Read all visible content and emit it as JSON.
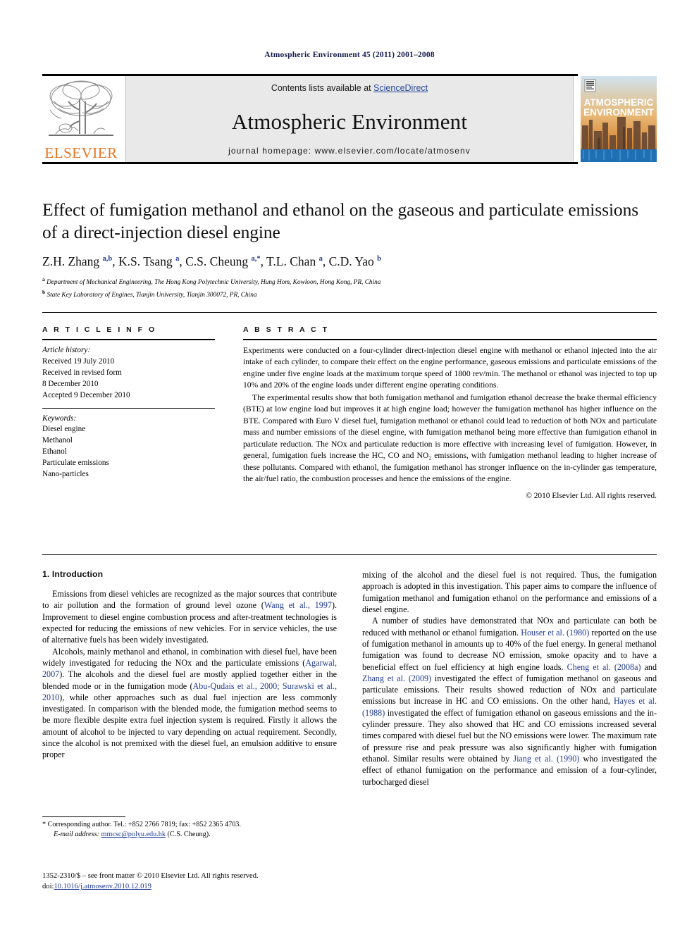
{
  "running_head": "Atmospheric Environment 45 (2011) 2001–2008",
  "masthead": {
    "contents_prefix": "Contents lists available at ",
    "contents_link": "ScienceDirect",
    "journal_name": "Atmospheric Environment",
    "homepage": "journal homepage: www.elsevier.com/locate/atmosenv",
    "publisher": "ELSEVIER",
    "cover_title_line1": "ATMOSPHERIC",
    "cover_title_line2": "ENVIRONMENT"
  },
  "article": {
    "title": "Effect of fumigation methanol and ethanol on the gaseous and particulate emissions of a direct-injection diesel engine",
    "authors_html": "Z.H. Zhang <sup>a,b</sup>, K.S. Tsang <sup>a</sup>, C.S. Cheung <sup>a,*</sup>, T.L. Chan <sup>a</sup>, C.D. Yao <sup>b</sup>",
    "affiliations": [
      "Department of Mechanical Engineering, The Hong Kong Polytechnic University, Hung Hom, Kowloon, Hong Kong, PR, China",
      "State Key Laboratory of Engines, Tianjin University, Tianjin 300072, PR, China"
    ],
    "affiliation_marks": [
      "a",
      "b"
    ]
  },
  "article_info": {
    "heading": "A R T I C L E   I N F O",
    "history_label": "Article history:",
    "history": [
      "Received 19 July 2010",
      "Received in revised form",
      "8 December 2010",
      "Accepted 9 December 2010"
    ],
    "keywords_label": "Keywords:",
    "keywords": [
      "Diesel engine",
      "Methanol",
      "Ethanol",
      "Particulate emissions",
      "Nano-particles"
    ]
  },
  "abstract": {
    "heading": "A B S T R A C T",
    "p1": "Experiments were conducted on a four-cylinder direct-injection diesel engine with methanol or ethanol injected into the air intake of each cylinder, to compare their effect on the engine performance, gaseous emissions and particulate emissions of the engine under five engine loads at the maximum torque speed of 1800 rev/min. The methanol or ethanol was injected to top up 10% and 20% of the engine loads under different engine operating conditions.",
    "p2": "The experimental results show that both fumigation methanol and fumigation ethanol decrease the brake thermal efficiency (BTE) at low engine load but improves it at high engine load; however the fumigation methanol has higher influence on the BTE. Compared with Euro V diesel fuel, fumigation methanol or ethanol could lead to reduction of both NOx and particulate mass and number emissions of the diesel engine, with fumigation methanol being more effective than fumigation ethanol in particulate reduction. The NOx and particulate reduction is more effective with increasing level of fumigation. However, in general, fumigation fuels increase the HC, CO and NO₂ emissions, with fumigation methanol leading to higher increase of these pollutants. Compared with ethanol, the fumigation methanol has stronger influence on the in-cylinder gas temperature, the air/fuel ratio, the combustion processes and hence the emissions of the engine.",
    "copyright": "© 2010 Elsevier Ltd. All rights reserved."
  },
  "body": {
    "section_number_title": "1. Introduction",
    "left_paragraphs": [
      "Emissions from diesel vehicles are recognized as the major sources that contribute to air pollution and the formation of ground level ozone (Wang et al., 1997). Improvement to diesel engine combustion process and after-treatment technologies is expected for reducing the emissions of new vehicles. For in service vehicles, the use of alternative fuels has been widely investigated.",
      "Alcohols, mainly methanol and ethanol, in combination with diesel fuel, have been widely investigated for reducing the NOx and the particulate emissions (Agarwal, 2007). The alcohols and the diesel fuel are mostly applied together either in the blended mode or in the fumigation mode (Abu-Qudais et al., 2000; Surawski et al., 2010), while other approaches such as dual fuel injection are less commonly investigated. In comparison with the blended mode, the fumigation method seems to be more flexible despite extra fuel injection system is required. Firstly it allows the amount of alcohol to be injected to vary depending on actual requirement. Secondly, since the alcohol is not premixed with the diesel fuel, an emulsion additive to ensure proper"
    ],
    "right_paragraphs": [
      "mixing of the alcohol and the diesel fuel is not required. Thus, the fumigation approach is adopted in this investigation. This paper aims to compare the influence of fumigation methanol and fumigation ethanol on the performance and emissions of a diesel engine.",
      "A number of studies have demonstrated that NOx and particulate can both be reduced with methanol or ethanol fumigation. Houser et al. (1980) reported on the use of fumigation methanol in amounts up to 40% of the fuel energy. In general methanol fumigation was found to decrease NO emission, smoke opacity and to have a beneficial effect on fuel efficiency at high engine loads. Cheng et al. (2008a) and Zhang et al. (2009) investigated the effect of fumigation methanol on gaseous and particulate emissions. Their results showed reduction of NOx and particulate emissions but increase in HC and CO emissions. On the other hand, Hayes et al. (1988) investigated the effect of fumigation ethanol on gaseous emissions and the in-cylinder pressure. They also showed that HC and CO emissions increased several times compared with diesel fuel but the NO emissions were lower. The maximum rate of pressure rise and peak pressure was also significantly higher with fumigation ethanol. Similar results were obtained by Jiang et al. (1990) who investigated the effect of ethanol fumigation on the performance and emission of a four-cylinder, turbocharged diesel"
    ],
    "citations_left": [
      "Wang et al., 1997",
      "Agarwal, 2007",
      "Abu-Qudais et al., 2000; Surawski et al., 2010"
    ],
    "citations_right": [
      "Houser et al. (1980)",
      "Cheng et al. (2008a)",
      "Zhang et al. (2009)",
      "Hayes et al. (1988)",
      "Jiang et al. (1990)"
    ]
  },
  "footnote": {
    "corresponding": "* Corresponding author. Tel.: +852 2766 7819; fax: +852 2365 4703.",
    "email_label": "E-mail address:",
    "email": "mmcsc@polyu.edu.hk",
    "email_owner": "(C.S. Cheung)."
  },
  "imprint": {
    "line1": "1352-2310/$ – see front matter © 2010 Elsevier Ltd. All rights reserved.",
    "doi_label": "doi:",
    "doi": "10.1016/j.atmosenv.2010.12.019"
  },
  "colors": {
    "link": "#1f3a93",
    "elsevier_orange": "#e87722",
    "runhead": "#141b4d",
    "masthead_bg": "#e9e9e9"
  }
}
